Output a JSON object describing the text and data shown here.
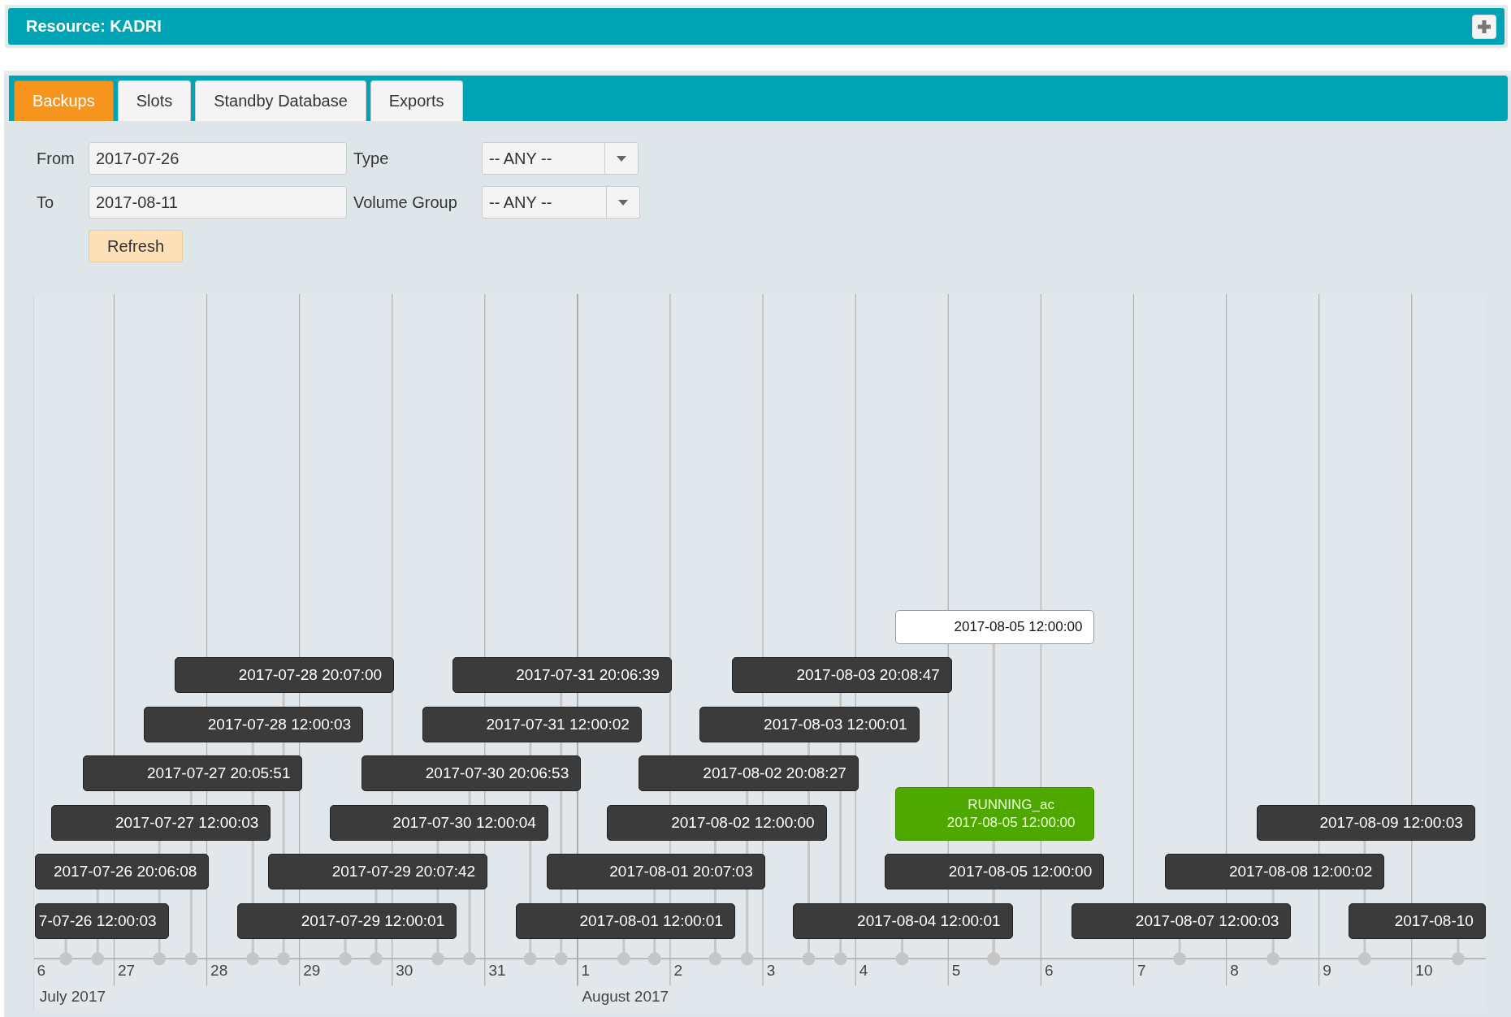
{
  "resource_panel": {
    "title": "Resource: KADRI"
  },
  "tabs": [
    {
      "label": "Backups",
      "selected": true
    },
    {
      "label": "Slots",
      "selected": false
    },
    {
      "label": "Standby Database",
      "selected": false
    },
    {
      "label": "Exports",
      "selected": false
    }
  ],
  "filters": {
    "from": {
      "label": "From",
      "value": "2017-07-26"
    },
    "to": {
      "label": "To",
      "value": "2017-08-11"
    },
    "type": {
      "label": "Type",
      "value": "-- ANY --"
    },
    "volume_group": {
      "label": "Volume Group",
      "value": "-- ANY --"
    },
    "refresh_button": "Refresh"
  },
  "timeline": {
    "day_labels": [
      "6",
      "27",
      "28",
      "29",
      "30",
      "31",
      "1",
      "2",
      "3",
      "4",
      "5",
      "6",
      "7",
      "8",
      "9",
      "10"
    ],
    "month_labels": [
      "July 2017",
      "August 2017"
    ],
    "events": [
      {
        "kind": "outline",
        "label": "2017-08-05 12:00:00"
      },
      {
        "kind": "dark",
        "label": "2017-07-28 20:07:00"
      },
      {
        "kind": "dark",
        "label": "2017-07-31 20:06:39"
      },
      {
        "kind": "dark",
        "label": "2017-08-03 20:08:47"
      },
      {
        "kind": "dark",
        "label": "2017-07-28 12:00:03"
      },
      {
        "kind": "dark",
        "label": "2017-07-31 12:00:02"
      },
      {
        "kind": "dark",
        "label": "2017-08-03 12:00:01"
      },
      {
        "kind": "dark",
        "label": "2017-07-27 20:05:51"
      },
      {
        "kind": "dark",
        "label": "2017-07-30 20:06:53"
      },
      {
        "kind": "dark",
        "label": "2017-08-02 20:08:27"
      },
      {
        "kind": "dark",
        "label": "2017-07-27 12:00:03"
      },
      {
        "kind": "dark",
        "label": "2017-07-30 12:00:04"
      },
      {
        "kind": "dark",
        "label": "2017-08-02 12:00:00"
      },
      {
        "kind": "running",
        "status": "RUNNING_ac",
        "label": "2017-08-05 12:00:00"
      },
      {
        "kind": "dark",
        "label": "2017-08-09 12:00:03"
      },
      {
        "kind": "dark",
        "label": "2017-07-26 20:06:08"
      },
      {
        "kind": "dark",
        "label": "2017-07-29 20:07:42"
      },
      {
        "kind": "dark",
        "label": "2017-08-01 20:07:03"
      },
      {
        "kind": "dark",
        "label": "2017-08-05 12:00:00"
      },
      {
        "kind": "dark",
        "label": "2017-08-08 12:00:02"
      },
      {
        "kind": "dark",
        "label": "7-07-26 12:00:03"
      },
      {
        "kind": "dark",
        "label": "2017-07-29 12:00:01"
      },
      {
        "kind": "dark",
        "label": "2017-08-01 12:00:01"
      },
      {
        "kind": "dark",
        "label": "2017-08-04 12:00:01"
      },
      {
        "kind": "dark",
        "label": "2017-08-07 12:00:03"
      },
      {
        "kind": "dark",
        "label": "2017-08-10"
      }
    ]
  }
}
